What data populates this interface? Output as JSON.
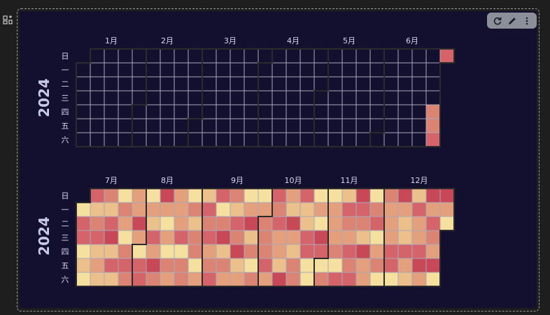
{
  "chart_data": {
    "type": "heatmap",
    "calendars": [
      {
        "year": "2024",
        "range": [
          "2024-01-01",
          "2024-06-30"
        ],
        "month_labels": [
          "1月",
          "2月",
          "3月",
          "4月",
          "5月",
          "6月"
        ],
        "day_labels": [
          "日",
          "一",
          "二",
          "三",
          "四",
          "五",
          "六"
        ],
        "values": [
          {
            "date": "2024-06-27",
            "level": 3
          },
          {
            "date": "2024-06-28",
            "level": 3
          },
          {
            "date": "2024-06-29",
            "level": 4
          },
          {
            "date": "2024-06-30",
            "level": 4
          }
        ]
      },
      {
        "year": "2024",
        "range": [
          "2024-07-01",
          "2024-12-31"
        ],
        "month_labels": [
          "7月",
          "8月",
          "9月",
          "10月",
          "11月",
          "12月"
        ],
        "day_labels": [
          "日",
          "一",
          "二",
          "三",
          "四",
          "五",
          "六"
        ],
        "values": "dense: every day has a value, levels 0 (pale yellow) to 5 (deep red)"
      }
    ],
    "color_scale": [
      "#f5e0a0",
      "#ecc08a",
      "#e4a07c",
      "#dc8474",
      "#d4646a",
      "#c94858"
    ],
    "empty_cell_color": "#120f2f",
    "grid_line_color": "#a9a9b8",
    "month_border_color": "#2b2b2b"
  },
  "toolbar": {
    "icons": [
      "refresh-icon",
      "edit-icon",
      "more-vertical-icon"
    ]
  },
  "side_icon": "widget-icon"
}
